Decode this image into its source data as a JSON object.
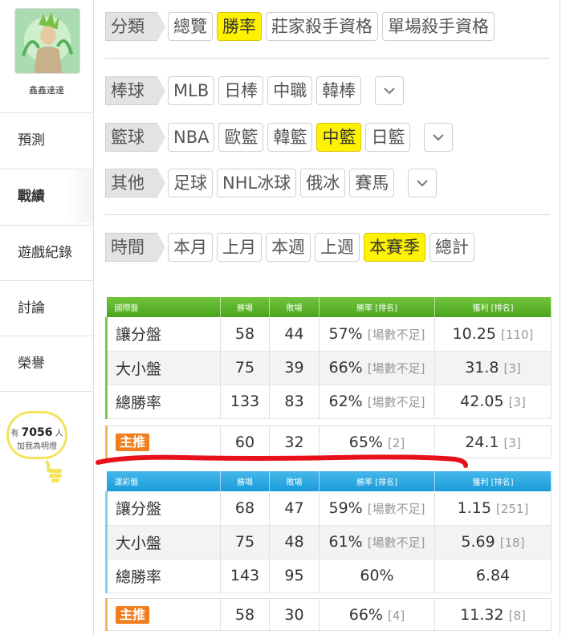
{
  "sidebar": {
    "username": "鑫鑫達達",
    "nav": [
      "預測",
      "戰績",
      "遊戲紀錄",
      "討論",
      "榮譽"
    ],
    "active_nav": "戰績",
    "fans": {
      "prefix": "有",
      "count": "7056",
      "suffix": "人",
      "caption": "加我為明燈"
    }
  },
  "filters": {
    "category": {
      "label": "分類",
      "options": [
        "總覽",
        "勝率",
        "莊家殺手資格",
        "單場殺手資格"
      ],
      "selected": "勝率"
    },
    "baseball": {
      "label": "棒球",
      "options": [
        "MLB",
        "日棒",
        "中職",
        "韓棒"
      ]
    },
    "basketball": {
      "label": "籃球",
      "options": [
        "NBA",
        "歐籃",
        "韓籃",
        "中籃",
        "日籃"
      ],
      "selected": "中籃"
    },
    "other": {
      "label": "其他",
      "options": [
        "足球",
        "NHL冰球",
        "俄冰",
        "賽馬"
      ]
    },
    "time": {
      "label": "時間",
      "options": [
        "本月",
        "上月",
        "本週",
        "上週",
        "本賽季",
        "總計"
      ],
      "selected": "本賽季"
    }
  },
  "international": {
    "headers": [
      "國際盤",
      "勝場",
      "敗場",
      "勝率 [排名]",
      "獲利 [排名]"
    ],
    "rows": [
      {
        "name": "讓分盤",
        "win": "58",
        "loss": "44",
        "rate": "57%",
        "rate_rank": "[場數不足]",
        "profit": "10.25",
        "profit_rank": "[110]"
      },
      {
        "name": "大小盤",
        "win": "75",
        "loss": "39",
        "rate": "66%",
        "rate_rank": "[場數不足]",
        "profit": "31.8",
        "profit_rank": "[3]"
      },
      {
        "name": "總勝率",
        "win": "133",
        "loss": "83",
        "rate": "62%",
        "rate_rank": "[場數不足]",
        "profit": "42.05",
        "profit_rank": "[3]"
      }
    ],
    "pick": {
      "badge": "主推",
      "win": "60",
      "loss": "32",
      "rate": "65%",
      "rate_rank": "[2]",
      "profit": "24.1",
      "profit_rank": "[3]"
    }
  },
  "lottery": {
    "headers": [
      "運彩盤",
      "勝場",
      "敗場",
      "勝率 [排名]",
      "獲利 [排名]"
    ],
    "rows": [
      {
        "name": "讓分盤",
        "win": "68",
        "loss": "47",
        "rate": "59%",
        "rate_rank": "[場數不足]",
        "profit": "1.15",
        "profit_rank": "[251]"
      },
      {
        "name": "大小盤",
        "win": "75",
        "loss": "48",
        "rate": "61%",
        "rate_rank": "[場數不足]",
        "profit": "5.69",
        "profit_rank": "[18]"
      },
      {
        "name": "總勝率",
        "win": "143",
        "loss": "95",
        "rate": "60%",
        "rate_rank": "",
        "profit": "6.84",
        "profit_rank": ""
      }
    ],
    "pick": {
      "badge": "主推",
      "win": "58",
      "loss": "30",
      "rate": "66%",
      "rate_rank": "[4]",
      "profit": "11.32",
      "profit_rank": "[8]"
    }
  },
  "colors": {
    "selected_chip": "#fef200",
    "green_header": "#5bb52a",
    "blue_header": "#2aa8e2",
    "badge": "#f07d1e",
    "annotation": "#e8101a"
  },
  "icons": {
    "dropdown": "chevron-down-icon",
    "bulb": "lightbulb-icon"
  }
}
